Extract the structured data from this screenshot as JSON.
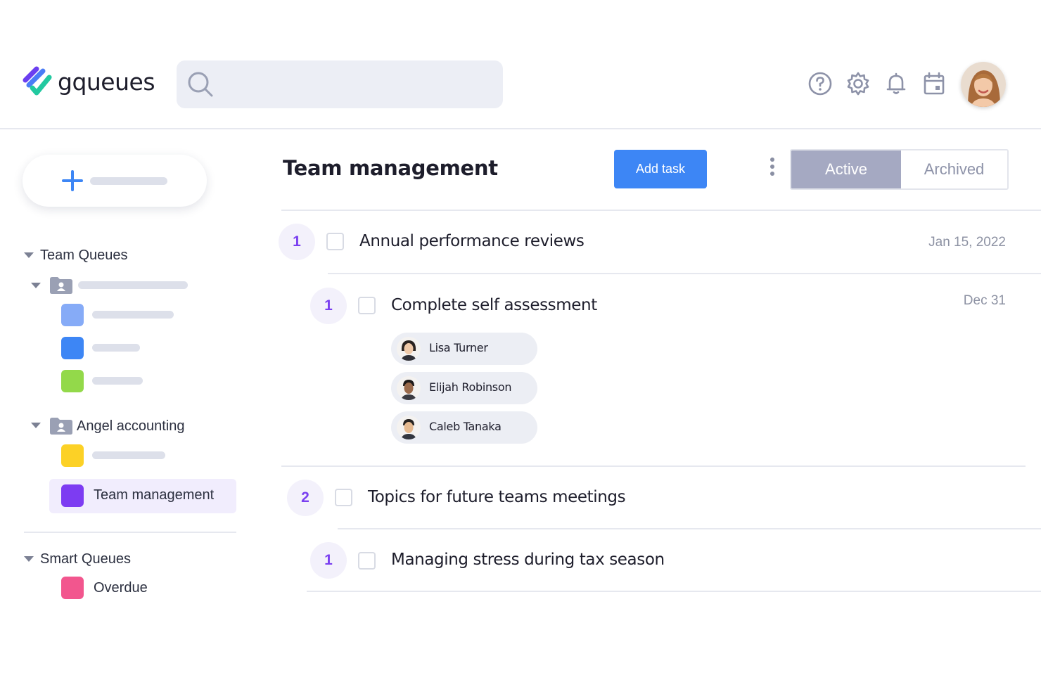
{
  "app": {
    "name": "gqueues"
  },
  "search": {
    "placeholder": "",
    "value": ""
  },
  "header": {
    "icons": [
      "help-icon",
      "settings-icon",
      "bell-icon",
      "calendar-icon"
    ]
  },
  "sidebar": {
    "team_queues_label": "Team Queues",
    "folder_2_label": "Angel accounting",
    "active_queue_label": "Team management",
    "smart_queues_label": "Smart Queues",
    "smart_items": [
      {
        "label": "Overdue",
        "color": "#f2568e"
      }
    ],
    "queue_colors": {
      "light_blue": "#86abf7",
      "blue": "#3d86f5",
      "green": "#93d94a",
      "yellow": "#fcd126",
      "purple": "#7d3cf2"
    }
  },
  "main": {
    "title": "Team management",
    "add_task_label": "Add task",
    "tabs": {
      "active": "Active",
      "archived": "Archived"
    },
    "tasks": [
      {
        "count": "1",
        "title": "Annual performance reviews",
        "date": "Jan 15, 2022"
      },
      {
        "count": "1",
        "title": "Complete self assessment",
        "date": "Dec 31",
        "assignees": [
          "Lisa Turner",
          "Elijah Robinson",
          "Caleb Tanaka"
        ]
      },
      {
        "count": "2",
        "title": "Topics for future teams meetings",
        "date": ""
      },
      {
        "count": "1",
        "title": "Managing stress during tax season",
        "date": ""
      }
    ]
  },
  "colors": {
    "accent": "#3d86f5",
    "count_text": "#7a3ff0",
    "active_tab": "#a5a9c2"
  }
}
